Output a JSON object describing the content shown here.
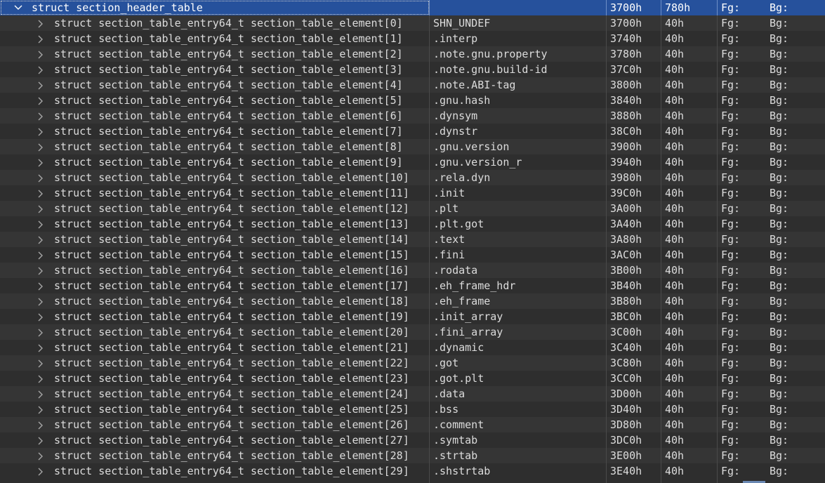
{
  "header_row": {
    "label": "struct section_header_table",
    "value": "",
    "start": "3700h",
    "size": "780h",
    "fg": "Fg:",
    "bg": "Bg:"
  },
  "rows": [
    {
      "label": "struct section_table_entry64_t section_table_element[0]",
      "value": "SHN_UNDEF",
      "start": "3700h",
      "size": "40h",
      "fg": "Fg:",
      "bg": "Bg:"
    },
    {
      "label": "struct section_table_entry64_t section_table_element[1]",
      "value": ".interp",
      "start": "3740h",
      "size": "40h",
      "fg": "Fg:",
      "bg": "Bg:"
    },
    {
      "label": "struct section_table_entry64_t section_table_element[2]",
      "value": ".note.gnu.property",
      "start": "3780h",
      "size": "40h",
      "fg": "Fg:",
      "bg": "Bg:"
    },
    {
      "label": "struct section_table_entry64_t section_table_element[3]",
      "value": ".note.gnu.build-id",
      "start": "37C0h",
      "size": "40h",
      "fg": "Fg:",
      "bg": "Bg:"
    },
    {
      "label": "struct section_table_entry64_t section_table_element[4]",
      "value": ".note.ABI-tag",
      "start": "3800h",
      "size": "40h",
      "fg": "Fg:",
      "bg": "Bg:"
    },
    {
      "label": "struct section_table_entry64_t section_table_element[5]",
      "value": ".gnu.hash",
      "start": "3840h",
      "size": "40h",
      "fg": "Fg:",
      "bg": "Bg:"
    },
    {
      "label": "struct section_table_entry64_t section_table_element[6]",
      "value": ".dynsym",
      "start": "3880h",
      "size": "40h",
      "fg": "Fg:",
      "bg": "Bg:"
    },
    {
      "label": "struct section_table_entry64_t section_table_element[7]",
      "value": ".dynstr",
      "start": "38C0h",
      "size": "40h",
      "fg": "Fg:",
      "bg": "Bg:"
    },
    {
      "label": "struct section_table_entry64_t section_table_element[8]",
      "value": ".gnu.version",
      "start": "3900h",
      "size": "40h",
      "fg": "Fg:",
      "bg": "Bg:"
    },
    {
      "label": "struct section_table_entry64_t section_table_element[9]",
      "value": ".gnu.version_r",
      "start": "3940h",
      "size": "40h",
      "fg": "Fg:",
      "bg": "Bg:"
    },
    {
      "label": "struct section_table_entry64_t section_table_element[10]",
      "value": ".rela.dyn",
      "start": "3980h",
      "size": "40h",
      "fg": "Fg:",
      "bg": "Bg:"
    },
    {
      "label": "struct section_table_entry64_t section_table_element[11]",
      "value": ".init",
      "start": "39C0h",
      "size": "40h",
      "fg": "Fg:",
      "bg": "Bg:"
    },
    {
      "label": "struct section_table_entry64_t section_table_element[12]",
      "value": ".plt",
      "start": "3A00h",
      "size": "40h",
      "fg": "Fg:",
      "bg": "Bg:"
    },
    {
      "label": "struct section_table_entry64_t section_table_element[13]",
      "value": ".plt.got",
      "start": "3A40h",
      "size": "40h",
      "fg": "Fg:",
      "bg": "Bg:"
    },
    {
      "label": "struct section_table_entry64_t section_table_element[14]",
      "value": ".text",
      "start": "3A80h",
      "size": "40h",
      "fg": "Fg:",
      "bg": "Bg:"
    },
    {
      "label": "struct section_table_entry64_t section_table_element[15]",
      "value": ".fini",
      "start": "3AC0h",
      "size": "40h",
      "fg": "Fg:",
      "bg": "Bg:"
    },
    {
      "label": "struct section_table_entry64_t section_table_element[16]",
      "value": ".rodata",
      "start": "3B00h",
      "size": "40h",
      "fg": "Fg:",
      "bg": "Bg:"
    },
    {
      "label": "struct section_table_entry64_t section_table_element[17]",
      "value": ".eh_frame_hdr",
      "start": "3B40h",
      "size": "40h",
      "fg": "Fg:",
      "bg": "Bg:"
    },
    {
      "label": "struct section_table_entry64_t section_table_element[18]",
      "value": ".eh_frame",
      "start": "3B80h",
      "size": "40h",
      "fg": "Fg:",
      "bg": "Bg:"
    },
    {
      "label": "struct section_table_entry64_t section_table_element[19]",
      "value": ".init_array",
      "start": "3BC0h",
      "size": "40h",
      "fg": "Fg:",
      "bg": "Bg:"
    },
    {
      "label": "struct section_table_entry64_t section_table_element[20]",
      "value": ".fini_array",
      "start": "3C00h",
      "size": "40h",
      "fg": "Fg:",
      "bg": "Bg:"
    },
    {
      "label": "struct section_table_entry64_t section_table_element[21]",
      "value": ".dynamic",
      "start": "3C40h",
      "size": "40h",
      "fg": "Fg:",
      "bg": "Bg:"
    },
    {
      "label": "struct section_table_entry64_t section_table_element[22]",
      "value": ".got",
      "start": "3C80h",
      "size": "40h",
      "fg": "Fg:",
      "bg": "Bg:"
    },
    {
      "label": "struct section_table_entry64_t section_table_element[23]",
      "value": ".got.plt",
      "start": "3CC0h",
      "size": "40h",
      "fg": "Fg:",
      "bg": "Bg:"
    },
    {
      "label": "struct section_table_entry64_t section_table_element[24]",
      "value": ".data",
      "start": "3D00h",
      "size": "40h",
      "fg": "Fg:",
      "bg": "Bg:"
    },
    {
      "label": "struct section_table_entry64_t section_table_element[25]",
      "value": ".bss",
      "start": "3D40h",
      "size": "40h",
      "fg": "Fg:",
      "bg": "Bg:"
    },
    {
      "label": "struct section_table_entry64_t section_table_element[26]",
      "value": ".comment",
      "start": "3D80h",
      "size": "40h",
      "fg": "Fg:",
      "bg": "Bg:"
    },
    {
      "label": "struct section_table_entry64_t section_table_element[27]",
      "value": ".symtab",
      "start": "3DC0h",
      "size": "40h",
      "fg": "Fg:",
      "bg": "Bg:"
    },
    {
      "label": "struct section_table_entry64_t section_table_element[28]",
      "value": ".strtab",
      "start": "3E00h",
      "size": "40h",
      "fg": "Fg:",
      "bg": "Bg:"
    },
    {
      "label": "struct section_table_entry64_t section_table_element[29]",
      "value": ".shstrtab",
      "start": "3E40h",
      "size": "40h",
      "fg": "Fg:",
      "bg": "Bg:"
    }
  ],
  "colors": {
    "background": "#2d2d2d",
    "row_alt": "#353535",
    "selection": "#26519c",
    "text": "#dcdcdc",
    "chevron": "#a6a6a6"
  },
  "icons": {
    "expanded": "chevron-down-icon",
    "collapsed": "chevron-right-icon"
  }
}
